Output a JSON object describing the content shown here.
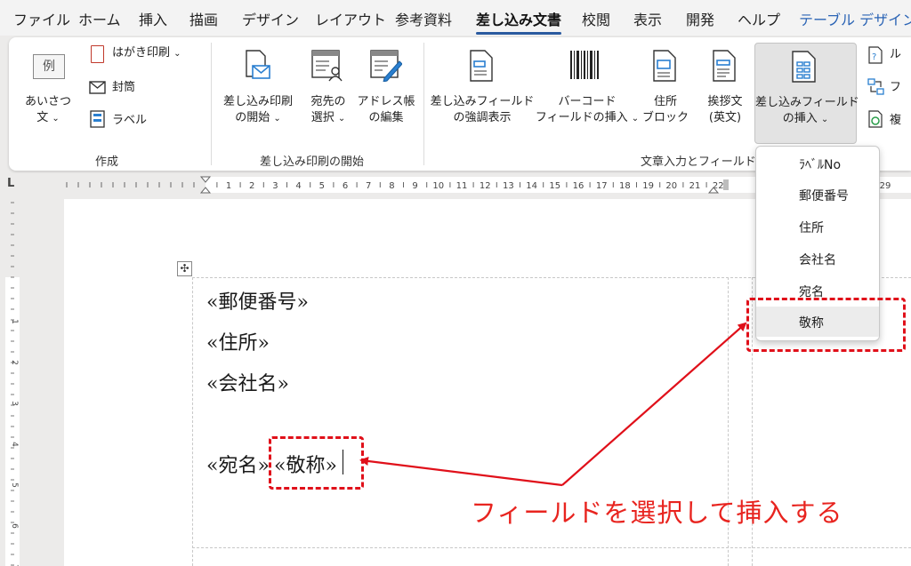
{
  "menu": {
    "tabs": [
      {
        "label": "ファイル"
      },
      {
        "label": "ホーム"
      },
      {
        "label": "挿入"
      },
      {
        "label": "描画"
      },
      {
        "label": "デザイン"
      },
      {
        "label": "レイアウト"
      },
      {
        "label": "参考資料"
      },
      {
        "label": "差し込み文書"
      },
      {
        "label": "校閲"
      },
      {
        "label": "表示"
      },
      {
        "label": "開発"
      },
      {
        "label": "ヘルプ"
      },
      {
        "label": "テーブル デザイン"
      }
    ],
    "active_tab": "差し込み文書"
  },
  "ribbon": {
    "create": {
      "greeting_line1": "あいさつ",
      "greeting_line2": "文",
      "greeting_icon_text": "例",
      "postcard": "はがき印刷",
      "envelope": "封筒",
      "label": "ラベル",
      "group_label": "作成"
    },
    "start": {
      "start_merge_line1": "差し込み印刷",
      "start_merge_line2": "の開始",
      "select_recipients_line1": "宛先の",
      "select_recipients_line2": "選択",
      "edit_list_line1": "アドレス帳",
      "edit_list_line2": "の編集",
      "group_label": "差し込み印刷の開始"
    },
    "fields": {
      "highlight_line1": "差し込みフィールド",
      "highlight_line2": "の強調表示",
      "barcode_line1": "バーコード",
      "barcode_line2": "フィールドの挿入",
      "address_line1": "住所",
      "address_line2": "ブロック",
      "greeting_line1": "挨拶文",
      "greeting_line2": "(英文)",
      "insert_field_line1": "差し込みフィールド",
      "insert_field_line2": "の挿入",
      "rules_label": "ル",
      "match_label": "フ",
      "update_label": "複",
      "group_label": "文章入力とフィールド"
    }
  },
  "ruler": {
    "numbers": [
      "1",
      "2",
      "3",
      "4",
      "5",
      "6",
      "7",
      "8",
      "9",
      "10",
      "11",
      "12",
      "13",
      "14",
      "15",
      "16",
      "17",
      "18",
      "19",
      "20",
      "21",
      "22",
      "29"
    ],
    "vertical_numbers": [
      "1",
      "2",
      "3",
      "4",
      "5",
      "6",
      "7"
    ],
    "corner_mark": "L"
  },
  "document": {
    "lines": [
      "«郵便番号»",
      "«住所»",
      "«会社名»"
    ],
    "name_field": "«宛名»",
    "honorific_field": "«敬称»"
  },
  "dropdown": {
    "items": [
      "ﾗﾍﾞﾙNo",
      "郵便番号",
      "住所",
      "会社名",
      "宛名",
      "敬称"
    ],
    "selected": "敬称"
  },
  "annotation": {
    "text": "フィールドを選択して挿入する"
  },
  "colors": {
    "accent": "#2a5a9f",
    "annotation_red": "#e0101a",
    "ribbon_bg": "#ffffff",
    "app_bg": "#ecebea"
  }
}
